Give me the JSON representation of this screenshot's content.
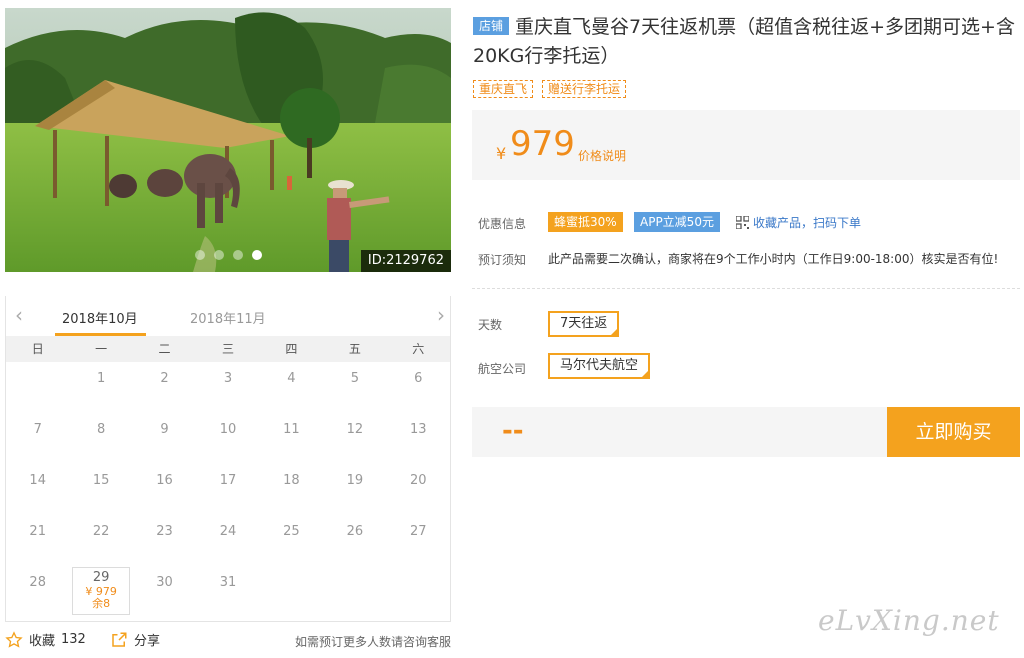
{
  "photo": {
    "id_label": "ID:2129762",
    "dots": 4,
    "active_dot": 3
  },
  "calendar": {
    "prev_arrow": "‹",
    "next_arrow": "›",
    "months": [
      "2018年10月",
      "2018年11月"
    ],
    "weekdays": [
      "日",
      "一",
      "二",
      "三",
      "四",
      "五",
      "六"
    ],
    "days": [
      "1",
      "2",
      "3",
      "4",
      "5",
      "6",
      "7",
      "8",
      "9",
      "10",
      "11",
      "12",
      "13",
      "14",
      "15",
      "16",
      "17",
      "18",
      "19",
      "20",
      "21",
      "22",
      "23",
      "24",
      "25",
      "26",
      "27",
      "28",
      "29",
      "30",
      "31"
    ],
    "first_weekday": 1,
    "selected_day": {
      "day": "29",
      "price": "¥ 979",
      "remaining": "余8"
    }
  },
  "actions": {
    "favorite_label": "收藏",
    "favorite_count": "132",
    "share_label": "分享",
    "consult_text": "如需预订更多人数请咨询客服"
  },
  "product": {
    "shop_badge": "店铺",
    "title": "重庆直飞曼谷7天往返机票（超值含税往返+多团期可选+含20KG行李托运）",
    "tags": [
      "重庆直飞",
      "赠送行李托运"
    ],
    "currency": "¥",
    "price": "979",
    "price_explain": "价格说明"
  },
  "promo": {
    "label": "优惠信息",
    "badge_orange": "蜂蜜抵30%",
    "badge_blue": "APP立减50元",
    "qr_text": "收藏产品，扫码下单"
  },
  "notice": {
    "label": "预订须知",
    "text": "此产品需要二次确认，商家将在9个工作小时内（工作日9:00-18:00）核实是否有位!"
  },
  "options": {
    "days_label": "天数",
    "days_value": "7天往返",
    "airline_label": "航空公司",
    "airline_value": "马尔代夫航空"
  },
  "buy": {
    "total": "--",
    "button": "立即购买"
  },
  "watermark": "eLvXing.net",
  "colors": {
    "accent_orange": "#f4a21e",
    "price_orange": "#f08c1a",
    "badge_blue": "#5b9fe0"
  }
}
